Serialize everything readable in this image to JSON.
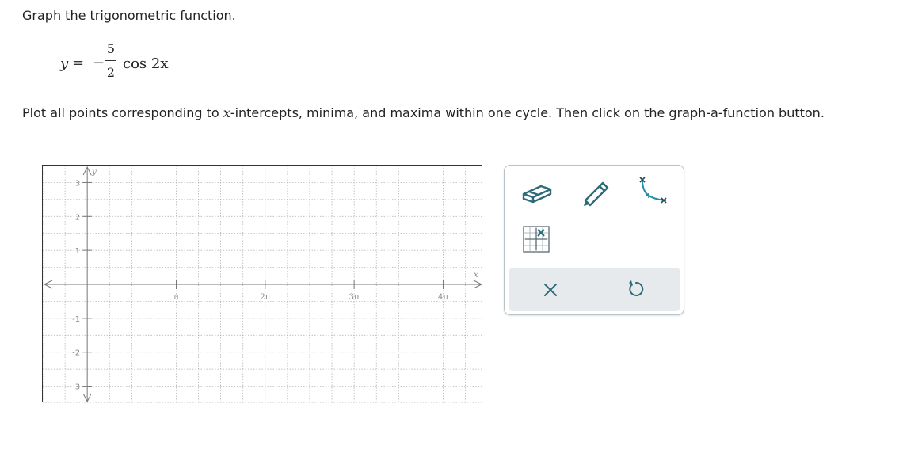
{
  "question": {
    "instruction": "Graph the trigonometric function.",
    "formula": {
      "lhs": "y",
      "equals": "=",
      "sign": "−",
      "numerator": "5",
      "denominator": "2",
      "rhs": "cos 2x"
    },
    "plot_text_before": "Plot all points corresponding to ",
    "plot_var": "x",
    "plot_text_after": "-intercepts, minima, and maxima within one cycle. Then click on the graph-a-function button."
  },
  "graph": {
    "x_axis_label": "x",
    "y_axis_label": "y",
    "x_tick_labels": [
      "π",
      "2π",
      "3π",
      "4π"
    ],
    "x_tick_values_in_pi": [
      1,
      2,
      3,
      4
    ],
    "y_tick_labels": [
      "3",
      "2",
      "1",
      "-1",
      "-2",
      "-3"
    ],
    "y_tick_values": [
      3,
      2,
      1,
      -1,
      -2,
      -3
    ],
    "x_range_in_pi": [
      -0.5,
      4.45
    ],
    "y_range": [
      -3.5,
      3.5
    ],
    "grid": true,
    "colors": {
      "axis": "#777777",
      "grid": "#aaaaaa",
      "label": "#888888",
      "frame": "#333333"
    }
  },
  "toolbar": {
    "tools": [
      {
        "name": "eraser",
        "icon": "eraser-icon"
      },
      {
        "name": "pencil",
        "icon": "pencil-icon"
      },
      {
        "name": "sinusoid",
        "icon": "sinusoid-icon"
      },
      {
        "name": "graph-a-function",
        "icon": "graph-function-icon"
      }
    ],
    "actions": [
      {
        "name": "clear",
        "icon": "x-icon"
      },
      {
        "name": "undo",
        "icon": "undo-icon"
      }
    ],
    "colors": {
      "icon": "#2e6b78",
      "accent": "#1f8ea3",
      "border": "#b8c3c8",
      "strip": "#e6eaec"
    }
  }
}
